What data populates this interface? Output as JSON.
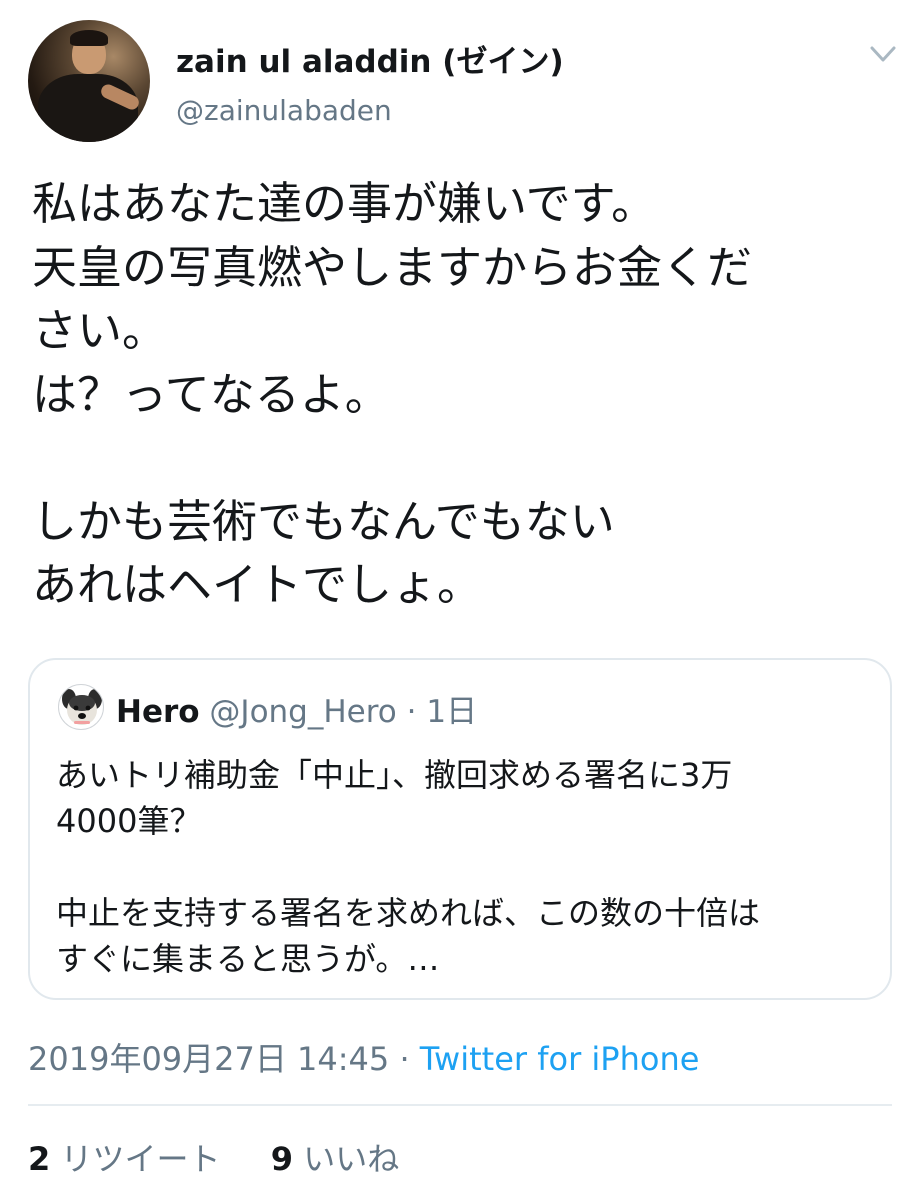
{
  "user": {
    "name": "zain ul aladdin (ゼイン)",
    "handle": "@zainulabaden",
    "avatar_icon": "user-avatar-photo"
  },
  "menu_icon": "chevron-down-icon",
  "tweet": {
    "text": "私はあなた達の事が嫌いです。\n天皇の写真燃やしますからお金くだ\nさい。\nは？ってなるよ。\n\nしかも芸術でもなんでもない\nあれはヘイトでしょ。"
  },
  "quote": {
    "avatar_icon": "dog-avatar",
    "name": "Hero",
    "handle": "@Jong_Hero",
    "separator": " · ",
    "time": "1日",
    "text": "あいトリ補助金「中止」、撤回求める署名に3万\n4000筆？\n\n中止を支持する署名を求めれば、この数の十倍は\nすぐに集まると思うが。…"
  },
  "meta": {
    "timestamp": "2019年09月27日 14:45",
    "separator": " · ",
    "client": "Twitter for iPhone"
  },
  "stats": {
    "retweet_count": "2",
    "retweet_label": "リツイート",
    "like_count": "9",
    "like_label": "いいね"
  },
  "colors": {
    "text": "#14171a",
    "secondary": "#657786",
    "link": "#1da1f2",
    "border": "#e1e8ed"
  }
}
